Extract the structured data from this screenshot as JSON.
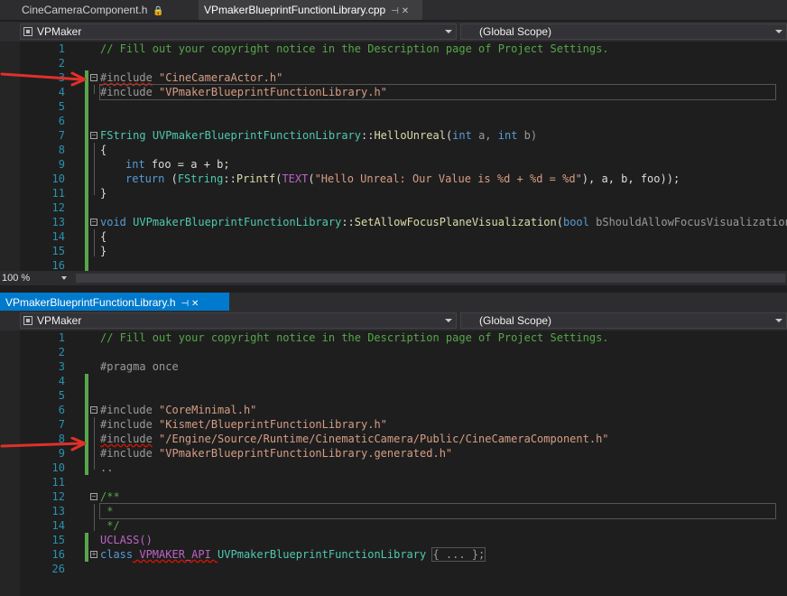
{
  "top": {
    "tabs": [
      {
        "label": "CineCameraComponent.h",
        "glyph": "🔒"
      },
      {
        "label": "VPmakerBlueprintFunctionLibrary.cpp",
        "glyph": "⊣  ✕"
      }
    ],
    "project_combo": "VPMaker",
    "scope_combo": "(Global Scope)",
    "zoom": "100 %",
    "lines": [
      {
        "n": "1"
      },
      {
        "n": "2"
      },
      {
        "n": "3"
      },
      {
        "n": "4"
      },
      {
        "n": "5"
      },
      {
        "n": "6"
      },
      {
        "n": "7"
      },
      {
        "n": "8"
      },
      {
        "n": "9"
      },
      {
        "n": "10"
      },
      {
        "n": "11"
      },
      {
        "n": "12"
      },
      {
        "n": "13"
      },
      {
        "n": "14"
      },
      {
        "n": "15"
      },
      {
        "n": "16"
      }
    ],
    "code": {
      "l1": "// Fill out your copyright notice in the Description page of Project Settings.",
      "l3_kw": "#include",
      "l3_str": "\"CineCameraActor.h\"",
      "l4_kw": "#include",
      "l4_str": "\"VPmakerBlueprintFunctionLibrary.h\"",
      "l7_type": "FString",
      "l7_cls": "UVPmakerBlueprintFunctionLibrary",
      "l7_sep": "::",
      "l7_fn": "HelloUnreal",
      "l7_p1": "(",
      "l7_int1": "int",
      "l7_a": " a, ",
      "l7_int2": "int",
      "l7_b": " b)",
      "l8": "{",
      "l9_kw": "int",
      "l9_rest": " foo = a + b;",
      "l10_ret": "return",
      "l10_a": " (",
      "l10_type": "FString",
      "l10_sep": "::",
      "l10_fn": "Printf",
      "l10_b": "(",
      "l10_mac": "TEXT",
      "l10_c": "(",
      "l10_str": "\"Hello Unreal: Our Value is %d + %d = %d\"",
      "l10_d": "), a, b, foo));",
      "l11": "}",
      "l13_kw": "void",
      "l13_cls": "UVPmakerBlueprintFunctionLibrary",
      "l13_sep": "::",
      "l13_fn": "SetAllowFocusPlaneVisualization",
      "l13_p": "(",
      "l13_bool": "bool",
      "l13_par": " bShouldAllowFocusVisualization",
      "l13_end": ")",
      "l14": "{",
      "l15": "}"
    }
  },
  "bottom": {
    "tab": {
      "label": "VPmakerBlueprintFunctionLibrary.h",
      "glyph": "⊣  ✕"
    },
    "project_combo": "VPMaker",
    "scope_combo": "(Global Scope)",
    "lines": [
      {
        "n": "1"
      },
      {
        "n": "2"
      },
      {
        "n": "3"
      },
      {
        "n": "4"
      },
      {
        "n": "5"
      },
      {
        "n": "6"
      },
      {
        "n": "7"
      },
      {
        "n": "8"
      },
      {
        "n": "9"
      },
      {
        "n": "10"
      },
      {
        "n": "11"
      },
      {
        "n": "12"
      },
      {
        "n": "13"
      },
      {
        "n": "14"
      },
      {
        "n": "15"
      },
      {
        "n": "16"
      },
      {
        "n": "26"
      }
    ],
    "code": {
      "l1": "// Fill out your copyright notice in the Description page of Project Settings.",
      "l3": "#pragma once",
      "l6_kw": "#include",
      "l6_str": "\"CoreMinimal.h\"",
      "l7_kw": "#include",
      "l7_str": "\"Kismet/BlueprintFunctionLibrary.h\"",
      "l8_kw": "#include",
      "l8_str": "\"/Engine/Source/Runtime/CinematicCamera/Public/CineCameraComponent.h\"",
      "l9_kw": "#include",
      "l9_str": "\"VPmakerBlueprintFunctionLibrary.generated.h\"",
      "l10": "..",
      "l12": "/**",
      "l13": " *",
      "l14": " */",
      "l15": "UCLASS()",
      "l16_kw": "class",
      "l16_api": " VPMAKER_API ",
      "l16_cls": "UVPmakerBlueprintFunctionLibrary",
      "l16_coll": "{ ... };"
    }
  },
  "colors": {
    "editor_bg": "#1e1e1e",
    "line_number": "#2b91af",
    "comment": "#57a64a",
    "keyword": "#569cd6",
    "string": "#d69d85",
    "type": "#4ec9b0",
    "accent": "#007acc",
    "annotation_arrow": "#e0302a"
  }
}
